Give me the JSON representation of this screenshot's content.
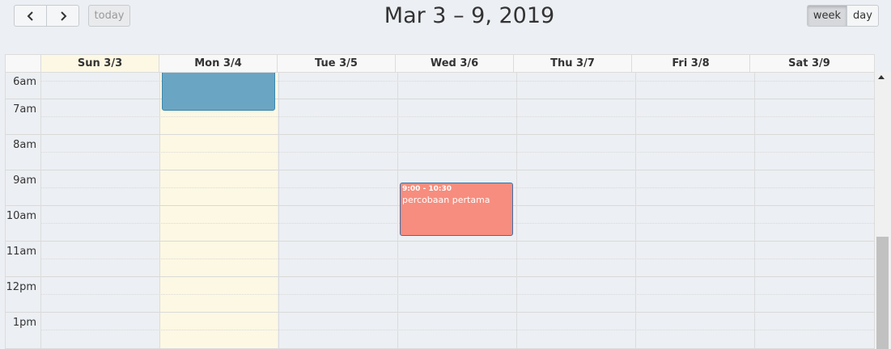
{
  "toolbar": {
    "prev_icon": "chevron-left-icon",
    "next_icon": "chevron-right-icon",
    "today_label": "today",
    "title": "Mar 3 – 9, 2019",
    "view_week": "week",
    "view_day": "day",
    "active_view": "week"
  },
  "columns": [
    {
      "label": "Sun 3/3"
    },
    {
      "label": "Mon 3/4",
      "is_today": true
    },
    {
      "label": "Tue 3/5"
    },
    {
      "label": "Wed 3/6"
    },
    {
      "label": "Thu 3/7"
    },
    {
      "label": "Fri 3/8"
    },
    {
      "label": "Sat 3/9"
    }
  ],
  "hours": [
    "6am",
    "7am",
    "8am",
    "9am",
    "10am",
    "11am",
    "12pm",
    "1pm"
  ],
  "events": [
    {
      "day": "Mon 3/4",
      "time": "",
      "title": "",
      "color": "#6ba5c4"
    },
    {
      "day": "Wed 3/6",
      "time": "9:00 - 10:30",
      "title": "percobaan pertama",
      "color": "#f78d7e"
    }
  ],
  "colors": {
    "today_bg": "#fcf8e3",
    "grid_line": "#dcdcdc"
  }
}
